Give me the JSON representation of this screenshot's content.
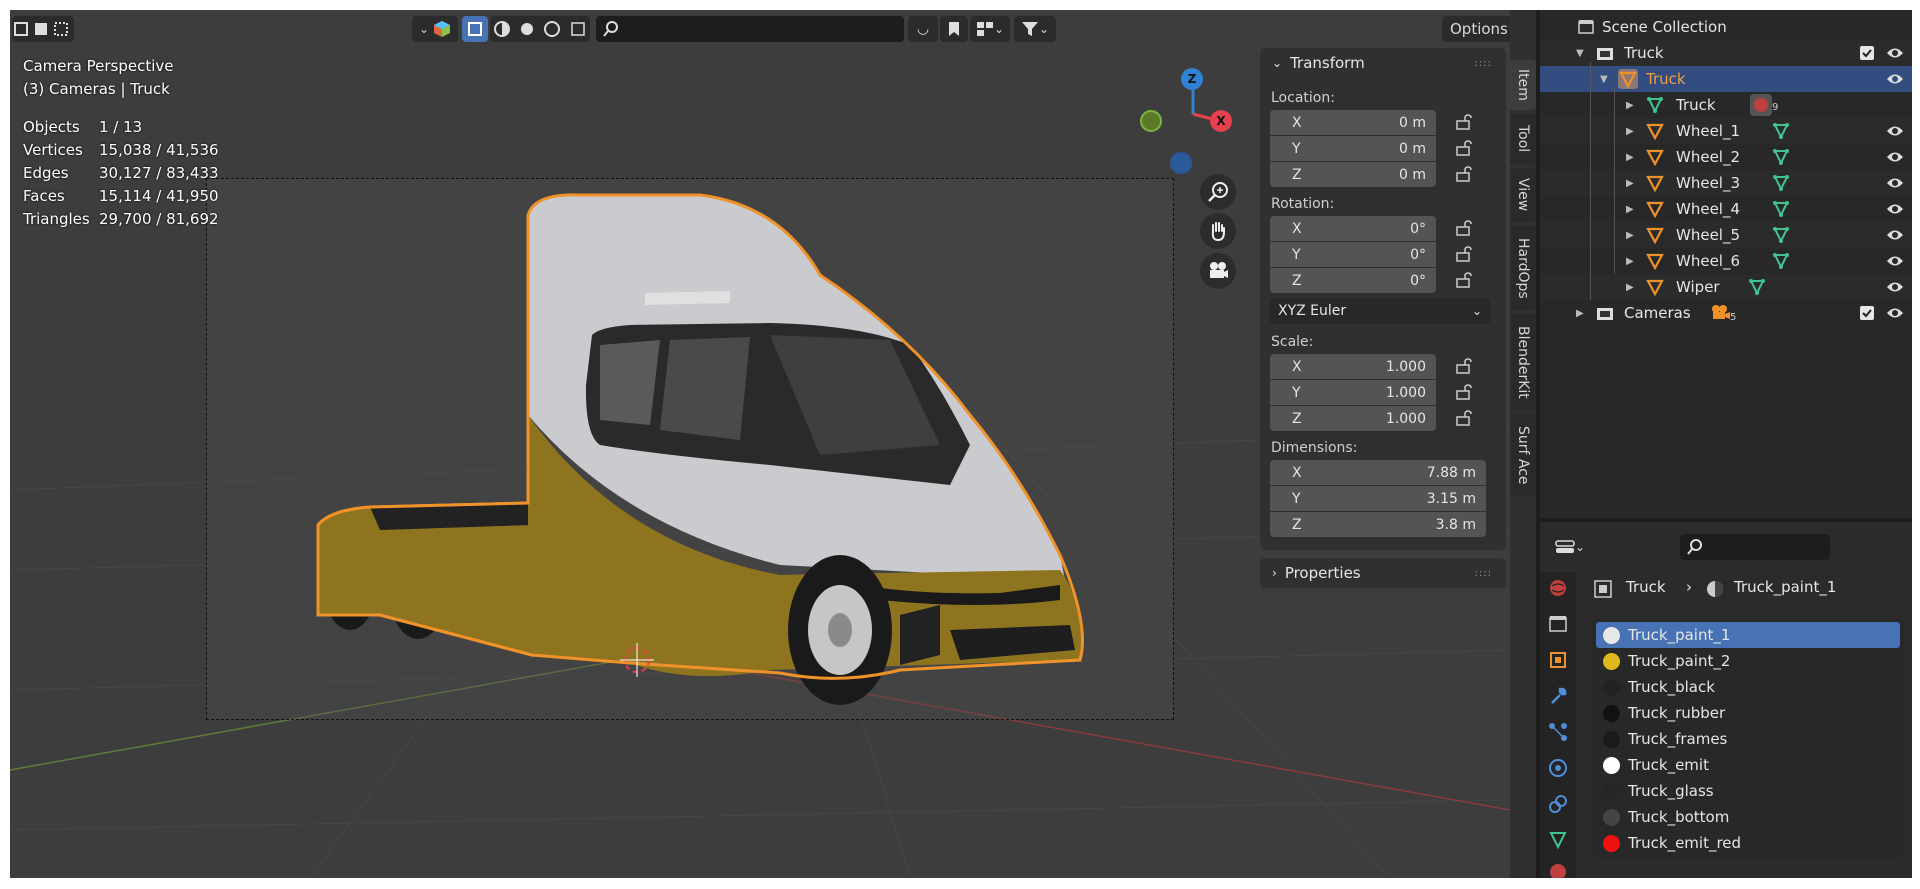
{
  "viewport": {
    "options_label": "Options",
    "camera_title": "Camera Perspective",
    "camera_subtitle": "(3) Cameras | Truck",
    "stats": [
      {
        "label": "Objects",
        "value": "1 / 13"
      },
      {
        "label": "Vertices",
        "value": "15,038 / 41,536"
      },
      {
        "label": "Edges",
        "value": "30,127 / 83,433"
      },
      {
        "label": "Faces",
        "value": "15,114 / 41,950"
      },
      {
        "label": "Triangles",
        "value": "29,700 / 81,692"
      }
    ],
    "gizmo": {
      "z": "Z",
      "x": "X"
    },
    "colors": {
      "x_axis": "#e5404e",
      "y_axis": "#7fb43e",
      "z_axis": "#2f82d6",
      "selection": "#f0922a",
      "paint": "#8f7420"
    }
  },
  "npanel": {
    "transform_title": "Transform",
    "location_label": "Location:",
    "location": [
      {
        "axis": "X",
        "value": "0 m"
      },
      {
        "axis": "Y",
        "value": "0 m"
      },
      {
        "axis": "Z",
        "value": "0 m"
      }
    ],
    "rotation_label": "Rotation:",
    "rotation": [
      {
        "axis": "X",
        "value": "0°"
      },
      {
        "axis": "Y",
        "value": "0°"
      },
      {
        "axis": "Z",
        "value": "0°"
      }
    ],
    "rotation_mode": "XYZ Euler",
    "scale_label": "Scale:",
    "scale": [
      {
        "axis": "X",
        "value": "1.000"
      },
      {
        "axis": "Y",
        "value": "1.000"
      },
      {
        "axis": "Z",
        "value": "1.000"
      }
    ],
    "dimensions_label": "Dimensions:",
    "dimensions": [
      {
        "axis": "X",
        "value": "7.88 m"
      },
      {
        "axis": "Y",
        "value": "3.15 m"
      },
      {
        "axis": "Z",
        "value": "3.8 m"
      }
    ],
    "properties_title": "Properties",
    "tabs": [
      "Item",
      "Tool",
      "View",
      "HardOps",
      "BlenderKit",
      "Surf Ace"
    ]
  },
  "outliner": {
    "root": "Scene Collection",
    "rows": [
      {
        "label": "Truck",
        "icon": "collection-icon"
      },
      {
        "label": "Truck",
        "icon": "empty-object-icon"
      },
      {
        "label": "Truck",
        "icon": "mesh-data-icon",
        "badge": "9"
      },
      {
        "label": "Wheel_1",
        "icon": "empty-object-icon"
      },
      {
        "label": "Wheel_2",
        "icon": "empty-object-icon"
      },
      {
        "label": "Wheel_3",
        "icon": "empty-object-icon"
      },
      {
        "label": "Wheel_4",
        "icon": "empty-object-icon"
      },
      {
        "label": "Wheel_5",
        "icon": "empty-object-icon"
      },
      {
        "label": "Wheel_6",
        "icon": "empty-object-icon"
      },
      {
        "label": "Wiper",
        "icon": "empty-object-icon"
      },
      {
        "label": "Cameras",
        "icon": "collection-icon",
        "badge": "5"
      }
    ]
  },
  "properties": {
    "breadcrumb_object": "Truck",
    "breadcrumb_material": "Truck_paint_1",
    "materials": [
      {
        "name": "Truck_paint_1",
        "color": "#e8e8e8"
      },
      {
        "name": "Truck_paint_2",
        "color": "#e0b81c"
      },
      {
        "name": "Truck_black",
        "color": "#222222"
      },
      {
        "name": "Truck_rubber",
        "color": "#111111"
      },
      {
        "name": "Truck_frames",
        "color": "#1a1a1a"
      },
      {
        "name": "Truck_emit",
        "color": "#ffffff"
      },
      {
        "name": "Truck_glass",
        "color": "#262626"
      },
      {
        "name": "Truck_bottom",
        "color": "#444444"
      },
      {
        "name": "Truck_emit_red",
        "color": "#ee1111"
      }
    ]
  }
}
